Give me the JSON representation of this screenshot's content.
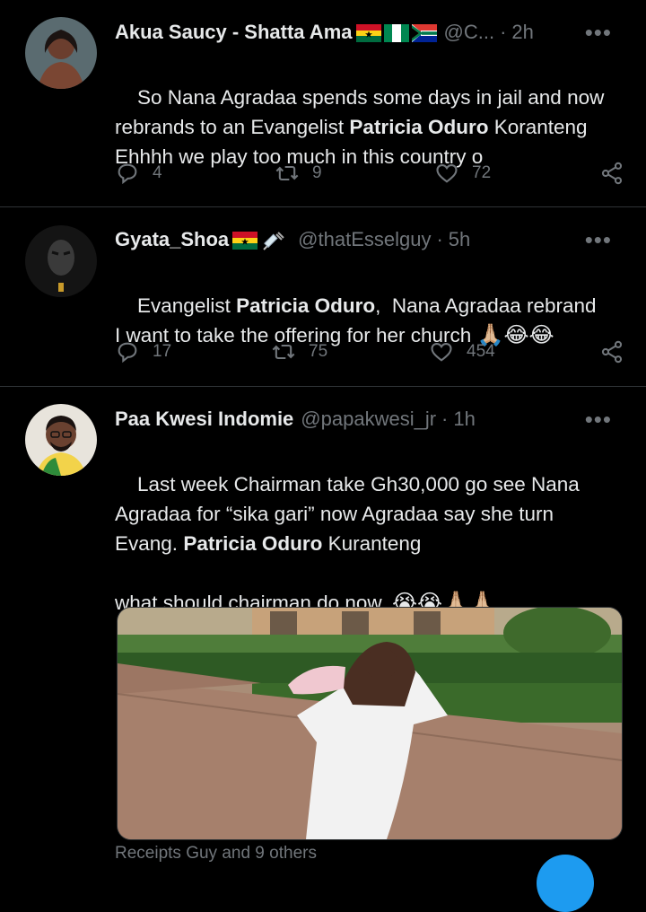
{
  "tweets": [
    {
      "name": "Akua Saucy - Shatta Ama",
      "flags": [
        "ghana-flag",
        "nigeria-flag",
        "south-africa-flag"
      ],
      "handle": "@C...",
      "time": "2h",
      "text_parts": [
        {
          "t": "So Nana Agradaa spends some days in jail and now\nrebrands to an Evangelist ",
          "b": false
        },
        {
          "t": "Patricia Oduro",
          "b": true
        },
        {
          "t": " Koranteng\nEhhhh we play too much in this country o",
          "b": false
        }
      ],
      "replies": "4",
      "retweets": "9",
      "likes": "72"
    },
    {
      "name": "Gyata_Shoa",
      "flags": [
        "ghana-flag",
        "syringe-emoji"
      ],
      "handle": "@thatEsselguy",
      "time": "5h",
      "text_parts": [
        {
          "t": "Evangelist ",
          "b": false
        },
        {
          "t": "Patricia Oduro",
          "b": true
        },
        {
          "t": ",  Nana Agradaa rebrand\nI want to take the offering for her church ",
          "b": false
        },
        {
          "t": "🙏🏼😂😂",
          "b": false
        }
      ],
      "replies": "17",
      "retweets": "75",
      "likes": "454"
    },
    {
      "name": "Paa Kwesi Indomie",
      "flags": [],
      "handle": "@papakwesi_jr",
      "time": "1h",
      "text_parts": [
        {
          "t": "Last week Chairman take Gh30,000 go see Nana\nAgradaa for “sika gari” now Agradaa say she turn\nEvang. ",
          "b": false
        },
        {
          "t": "Patricia Oduro",
          "b": true
        },
        {
          "t": " Kuranteng\n\nwhat should chairman do now. ",
          "b": false
        },
        {
          "t": "😭😭🙏🏼🙏🏼",
          "b": false
        }
      ]
    }
  ],
  "footer_text": "Receipts Guy and 9 others",
  "separator": "·",
  "more_label": "•••",
  "colors": {
    "background": "#000000",
    "text": "#e7e9ea",
    "muted": "#71767b",
    "divider": "#2f3336",
    "accent": "#1d9bf0"
  }
}
